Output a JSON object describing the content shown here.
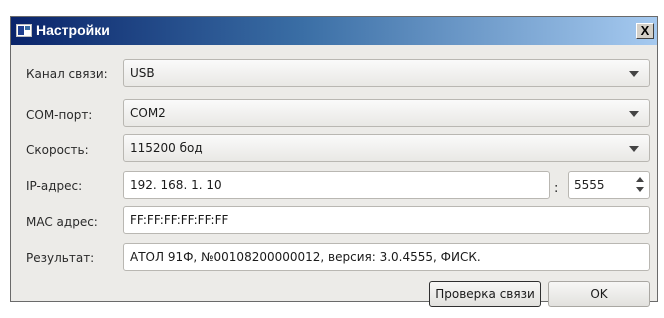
{
  "window": {
    "title": "Настройки",
    "icon": "window-app-icon",
    "close_label": "X"
  },
  "form": {
    "channel": {
      "label": "Канал связи:",
      "value": "USB"
    },
    "com_port": {
      "label": "COM-порт:",
      "value": "COM2"
    },
    "speed": {
      "label": "Скорость:",
      "value": "115200 бод"
    },
    "ip": {
      "label": "IP-адрес:",
      "value": "192. 168. 1. 10",
      "port_separator": ":",
      "port": "5555"
    },
    "mac": {
      "label": "MAC адрес:",
      "value": "FF:FF:FF:FF:FF:FF"
    },
    "result": {
      "label": "Результат:",
      "value": "АТОЛ 91Ф, №00108200000012, версия: 3.0.4555, ФИСК."
    }
  },
  "buttons": {
    "check": "Проверка связи",
    "ok": "OK"
  },
  "colors": {
    "title_gradient_start": "#0a246a",
    "title_gradient_end": "#a6caf0",
    "dialog_bg": "#ecebe8"
  }
}
